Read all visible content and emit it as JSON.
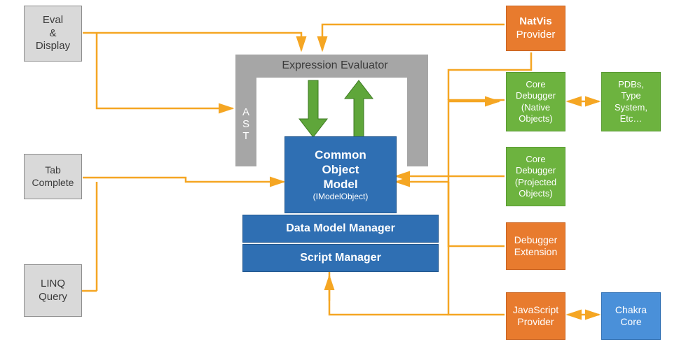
{
  "left": {
    "eval_display": "Eval\n&\nDisplay",
    "tab_complete": "Tab\nComplete",
    "linq_query": "LINQ\nQuery"
  },
  "center": {
    "expression_evaluator": "Expression Evaluator",
    "ast": "AST",
    "common_object_model_title": "Common\nObject\nModel",
    "common_object_model_sub": "(IModelObject)",
    "data_model_manager": "Data Model Manager",
    "script_manager": "Script Manager"
  },
  "right": {
    "natvis_bold": "NatVis",
    "natvis_sub": "Provider",
    "core_debugger_native": "Core\nDebugger\n(Native\nObjects)",
    "pdbs": "PDBs,\nType\nSystem,\nEtc…",
    "core_debugger_projected": "Core\nDebugger\n(Projected\nObjects)",
    "debugger_extension": "Debugger\nExtension",
    "javascript_provider": "JavaScript\nProvider",
    "chakra_core": "Chakra\nCore"
  },
  "colors": {
    "gray": "#d9d9d9",
    "orange": "#e87b2e",
    "green": "#6db33f",
    "blue_strong": "#2f6fb3",
    "blue_light": "#4a90d9",
    "arrow": "#f5a623",
    "green_arrow": "#4a8a2a"
  }
}
